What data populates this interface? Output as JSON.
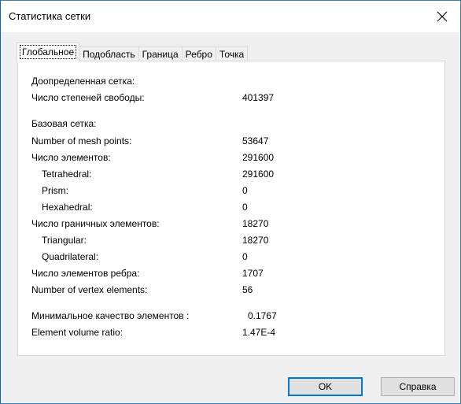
{
  "window": {
    "title": "Статистика сетки"
  },
  "tabs": [
    {
      "label": "Глобальное"
    },
    {
      "label": "Подобласть"
    },
    {
      "label": "Граница"
    },
    {
      "label": "Ребро"
    },
    {
      "label": "Точка"
    }
  ],
  "sections": {
    "refined_header": "Доопределенная сетка:",
    "base_header": "Базовая сетка:"
  },
  "stats": [
    {
      "label": "Число степеней свободы:",
      "value": "401397"
    },
    {
      "label": "Number of mesh points:",
      "value": "53647"
    },
    {
      "label": "Число элементов:",
      "value": "291600"
    },
    {
      "label": "Tetrahedral:",
      "value": "291600"
    },
    {
      "label": "Prism:",
      "value": "0"
    },
    {
      "label": "Hexahedral:",
      "value": "0"
    },
    {
      "label": "Число граничных элементов:",
      "value": "18270"
    },
    {
      "label": "Triangular:",
      "value": "18270"
    },
    {
      "label": "Quadrilateral:",
      "value": "0"
    },
    {
      "label": "Число элементов ребра:",
      "value": "1707"
    },
    {
      "label": "Number of vertex elements:",
      "value": "56"
    },
    {
      "label": "Минимальное качество элементов :",
      "value": "0.1767"
    },
    {
      "label": "Element volume ratio:",
      "value": "1.47E-4"
    }
  ],
  "buttons": {
    "ok": "OK",
    "help": "Справка"
  },
  "colors": {
    "accent": "#0078d7",
    "border": "#3c7fb1"
  }
}
